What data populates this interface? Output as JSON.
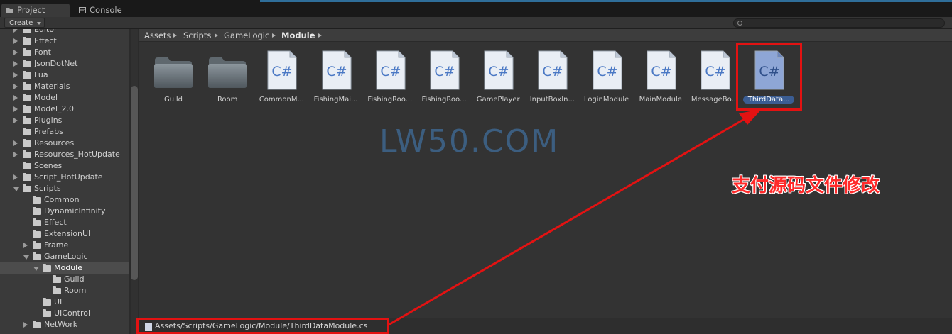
{
  "tabs": [
    {
      "label": "Project",
      "icon": "folder-icon",
      "active": true
    },
    {
      "label": "Console",
      "icon": "console-icon",
      "active": false
    }
  ],
  "toolbar": {
    "create_label": "Create",
    "search_value": ""
  },
  "tree": [
    {
      "label": "Editor",
      "depth": 0,
      "arrow": "right"
    },
    {
      "label": "Effect",
      "depth": 0,
      "arrow": "right"
    },
    {
      "label": "Font",
      "depth": 0,
      "arrow": "right"
    },
    {
      "label": "JsonDotNet",
      "depth": 0,
      "arrow": "right"
    },
    {
      "label": "Lua",
      "depth": 0,
      "arrow": "right"
    },
    {
      "label": "Materials",
      "depth": 0,
      "arrow": "right"
    },
    {
      "label": "Model",
      "depth": 0,
      "arrow": "right"
    },
    {
      "label": "Model_2.0",
      "depth": 0,
      "arrow": "right"
    },
    {
      "label": "Plugins",
      "depth": 0,
      "arrow": "right"
    },
    {
      "label": "Prefabs",
      "depth": 0,
      "arrow": "none"
    },
    {
      "label": "Resources",
      "depth": 0,
      "arrow": "right"
    },
    {
      "label": "Resources_HotUpdate",
      "depth": 0,
      "arrow": "right"
    },
    {
      "label": "Scenes",
      "depth": 0,
      "arrow": "none"
    },
    {
      "label": "Script_HotUpdate",
      "depth": 0,
      "arrow": "right"
    },
    {
      "label": "Scripts",
      "depth": 0,
      "arrow": "down"
    },
    {
      "label": "Common",
      "depth": 1,
      "arrow": "none"
    },
    {
      "label": "DynamicInfinity",
      "depth": 1,
      "arrow": "none"
    },
    {
      "label": "Effect",
      "depth": 1,
      "arrow": "none"
    },
    {
      "label": "ExtensionUI",
      "depth": 1,
      "arrow": "none"
    },
    {
      "label": "Frame",
      "depth": 1,
      "arrow": "right"
    },
    {
      "label": "GameLogic",
      "depth": 1,
      "arrow": "down"
    },
    {
      "label": "Module",
      "depth": 2,
      "arrow": "down",
      "selected": true
    },
    {
      "label": "Guild",
      "depth": 3,
      "arrow": "none"
    },
    {
      "label": "Room",
      "depth": 3,
      "arrow": "none"
    },
    {
      "label": "UI",
      "depth": 2,
      "arrow": "none"
    },
    {
      "label": "UIControl",
      "depth": 2,
      "arrow": "none"
    },
    {
      "label": "NetWork",
      "depth": 1,
      "arrow": "right"
    }
  ],
  "breadcrumb": [
    "Assets",
    "Scripts",
    "GameLogic",
    "Module"
  ],
  "assets": [
    {
      "label": "Guild",
      "kind": "folder"
    },
    {
      "label": "Room",
      "kind": "folder"
    },
    {
      "label": "CommonM...",
      "kind": "cs"
    },
    {
      "label": "FishingMai...",
      "kind": "cs"
    },
    {
      "label": "FishingRoo...",
      "kind": "cs"
    },
    {
      "label": "FishingRoo...",
      "kind": "cs"
    },
    {
      "label": "GamePlayer",
      "kind": "cs"
    },
    {
      "label": "InputBoxIn...",
      "kind": "cs"
    },
    {
      "label": "LoginModule",
      "kind": "cs"
    },
    {
      "label": "MainModule",
      "kind": "cs"
    },
    {
      "label": "MessageBo...",
      "kind": "cs"
    },
    {
      "label": "ThirdData...",
      "kind": "cs",
      "selected": true
    }
  ],
  "cs_glyph": "C#",
  "watermark": "LW50.COM",
  "annotation": "支付源码文件修改",
  "status": {
    "path": "Assets/Scripts/GameLogic/Module/ThirdDataModule.cs"
  },
  "colors": {
    "highlight": "#e31212",
    "selection": "#3b5d93",
    "watermark": "#3c5e80",
    "annotation": "#ff2a2a"
  }
}
